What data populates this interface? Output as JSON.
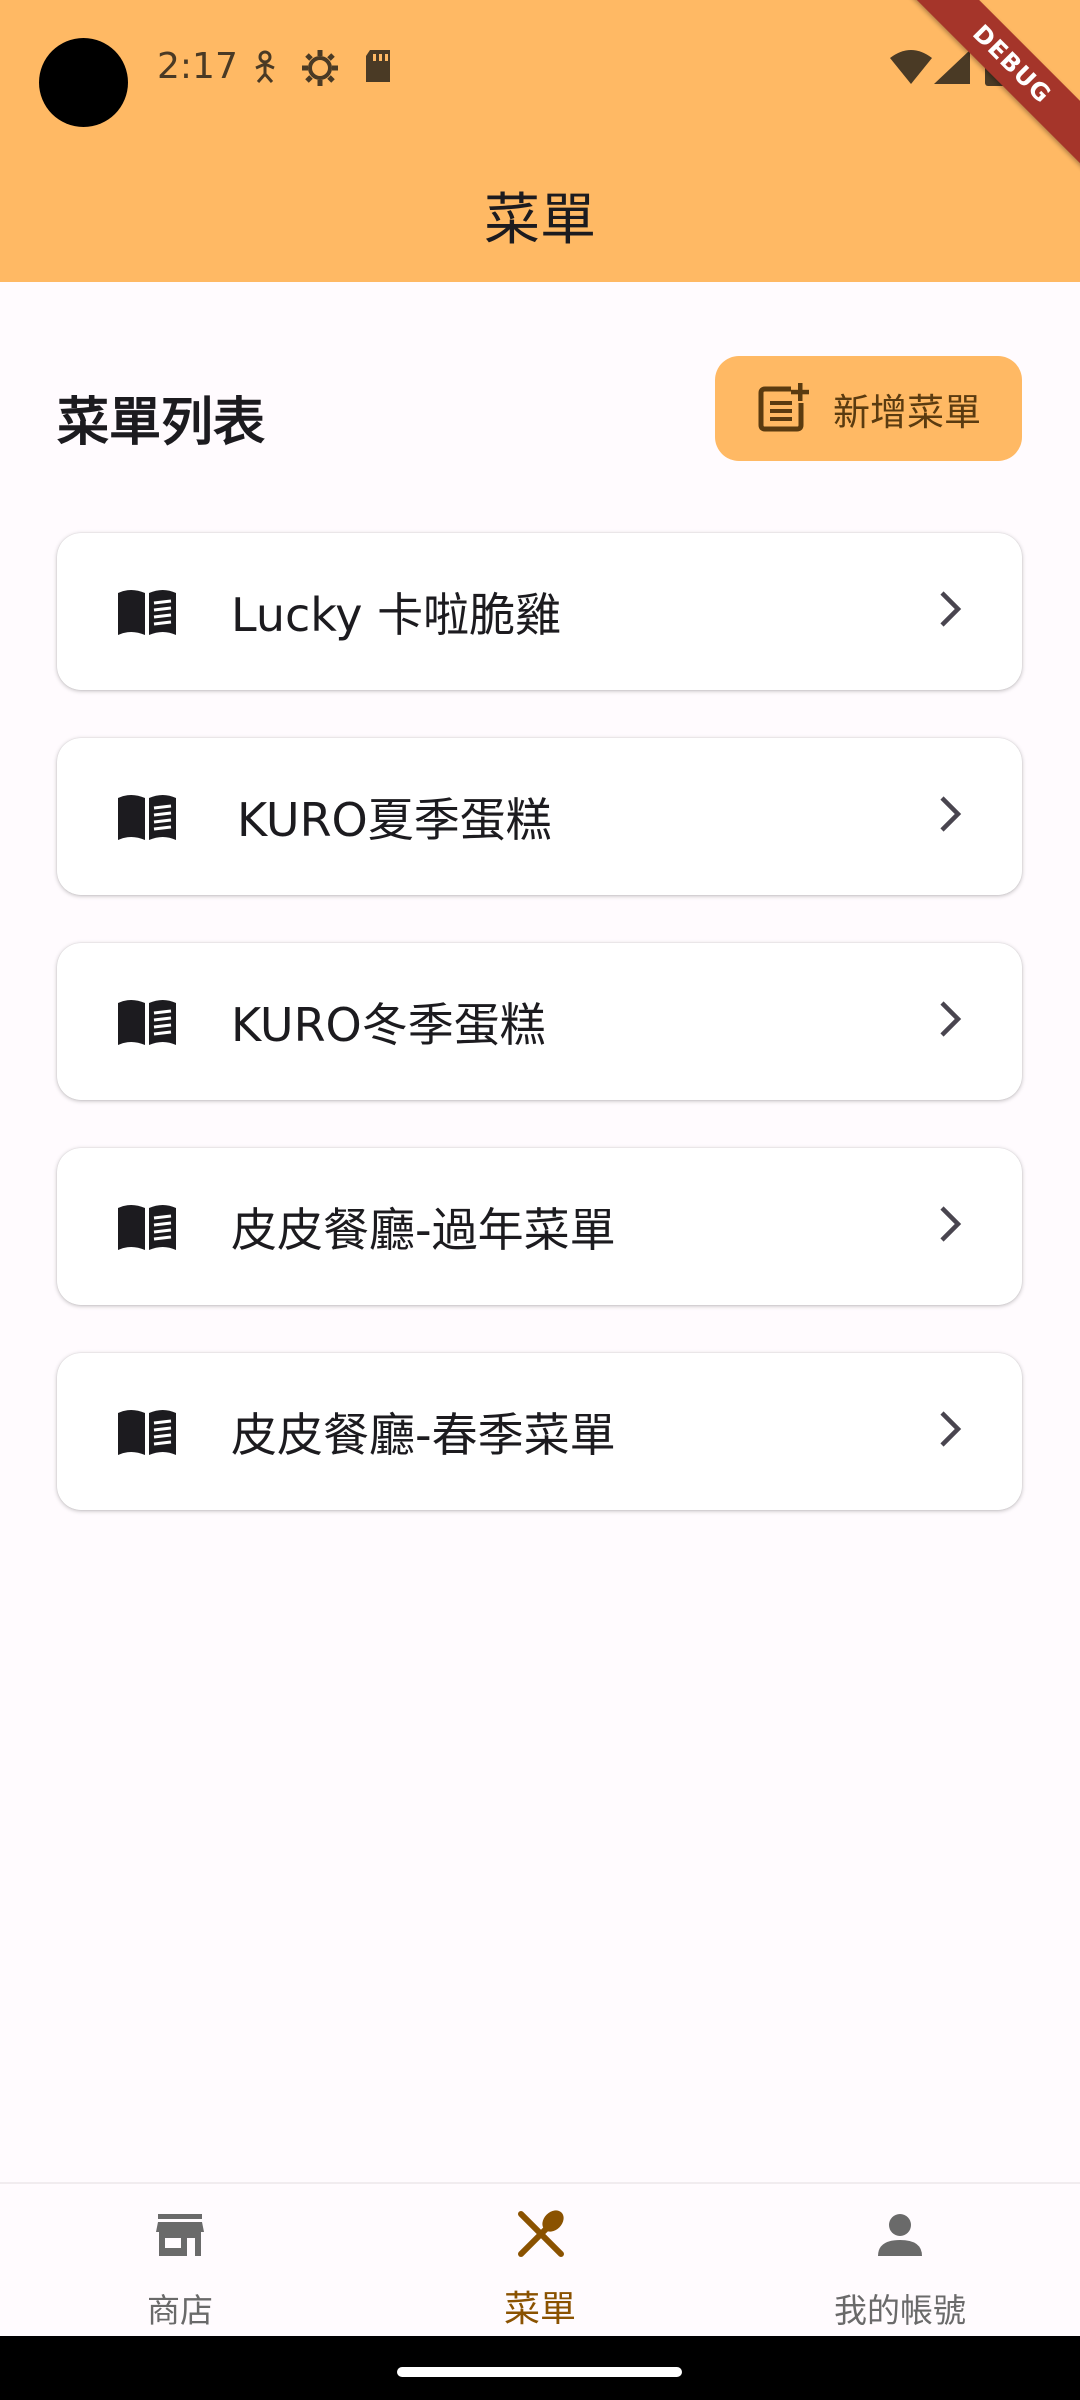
{
  "status_bar": {
    "time": "2:17"
  },
  "debug_banner": "DEBUG",
  "appbar": {
    "title": "菜單"
  },
  "header": {
    "heading": "菜單列表",
    "add_button_label": "新增菜單"
  },
  "menus": [
    {
      "label": "Lucky 卡啦脆雞"
    },
    {
      "label": "KURO夏季蛋糕"
    },
    {
      "label": "KURO冬季蛋糕"
    },
    {
      "label": "皮皮餐廳-過年菜單"
    },
    {
      "label": "皮皮餐廳-春季菜單"
    }
  ],
  "bottom_nav": {
    "items": [
      {
        "label": "商店",
        "icon": "store-icon"
      },
      {
        "label": "菜單",
        "icon": "restaurant-icon",
        "active": true
      },
      {
        "label": "我的帳號",
        "icon": "person-icon"
      }
    ]
  },
  "colors": {
    "primary": "#FFB964",
    "active_nav": "#8A5200",
    "background": "#FFFBFE"
  }
}
